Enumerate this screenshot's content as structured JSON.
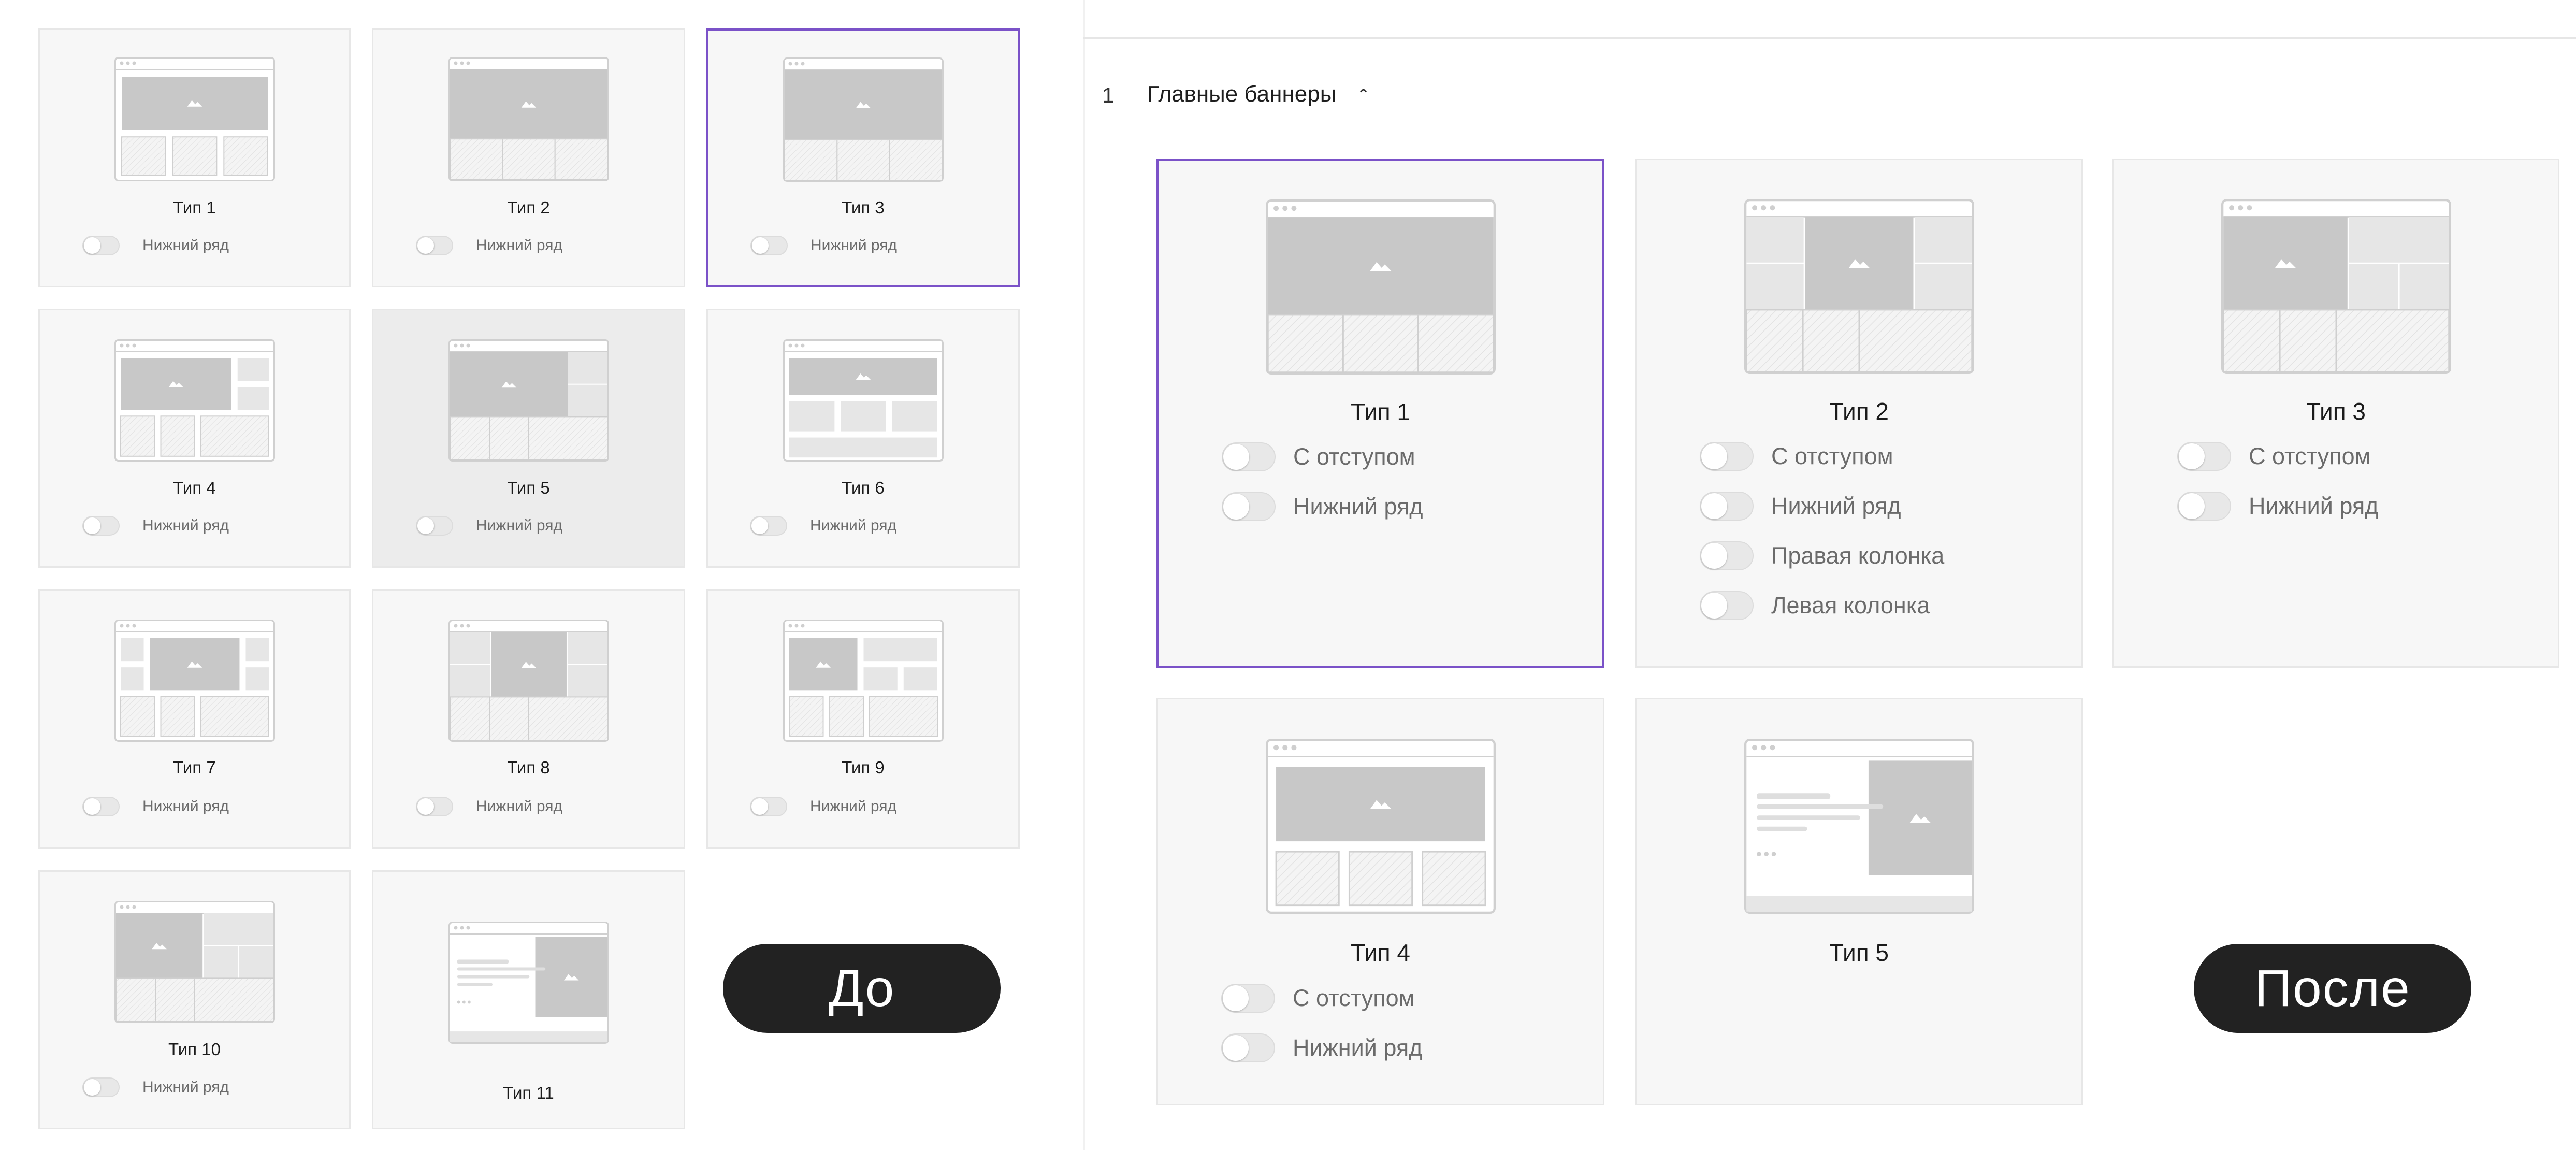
{
  "labels": {
    "before": "До",
    "after": "После"
  },
  "section": {
    "number": "1",
    "title": "Главные баннеры",
    "caret": "⌃"
  },
  "before_cards": [
    {
      "title": "Тип 1",
      "option": "Нижний ряд",
      "layout": "banner-row",
      "selected": false
    },
    {
      "title": "Тип 2",
      "option": "Нижний ряд",
      "layout": "banner-full-row",
      "selected": false
    },
    {
      "title": "Тип 3",
      "option": "Нижний ряд",
      "layout": "banner-full-row",
      "selected": true
    },
    {
      "title": "Тип 4",
      "option": "Нижний ряд",
      "layout": "banner-right-col",
      "selected": false
    },
    {
      "title": "Тип 5",
      "option": "Нижний ряд",
      "layout": "banner-right-split",
      "selected": false,
      "highlighted": true
    },
    {
      "title": "Тип 6",
      "option": "Нижний ряд",
      "layout": "banner-boxes",
      "selected": false
    },
    {
      "title": "Тип 7",
      "option": "Нижний ряд",
      "layout": "banner-both-cols",
      "selected": false
    },
    {
      "title": "Тип 8",
      "option": "Нижний ряд",
      "layout": "banner-center-split",
      "selected": false
    },
    {
      "title": "Тип 9",
      "option": "Нижний ряд",
      "layout": "banner-left-grid",
      "selected": false
    },
    {
      "title": "Тип 10",
      "option": "Нижний ряд",
      "layout": "banner-left-split",
      "selected": false
    },
    {
      "title": "Тип 11",
      "option": "",
      "layout": "text-image",
      "selected": false
    }
  ],
  "after_cards": [
    {
      "title": "Тип 1",
      "options": [
        "С отступом",
        "Нижний ряд"
      ],
      "layout": "banner-full-row",
      "selected": true
    },
    {
      "title": "Тип 2",
      "options": [
        "С отступом",
        "Нижний ряд",
        "Правая колонка",
        "Левая колонка"
      ],
      "layout": "banner-center-split",
      "selected": false
    },
    {
      "title": "Тип 3",
      "options": [
        "С отступом",
        "Нижний ряд"
      ],
      "layout": "banner-left-split",
      "selected": false
    },
    {
      "title": "Тип 4",
      "options": [
        "С отступом",
        "Нижний ряд"
      ],
      "layout": "banner-row",
      "selected": false
    },
    {
      "title": "Тип 5",
      "options": [],
      "layout": "text-image",
      "selected": false
    }
  ],
  "colors": {
    "accent": "#7b52c8",
    "card_bg": "#f7f7f7",
    "card_border": "#e7e7e7",
    "placeholder": "#c8c8c8",
    "pill_bg": "#222222"
  }
}
